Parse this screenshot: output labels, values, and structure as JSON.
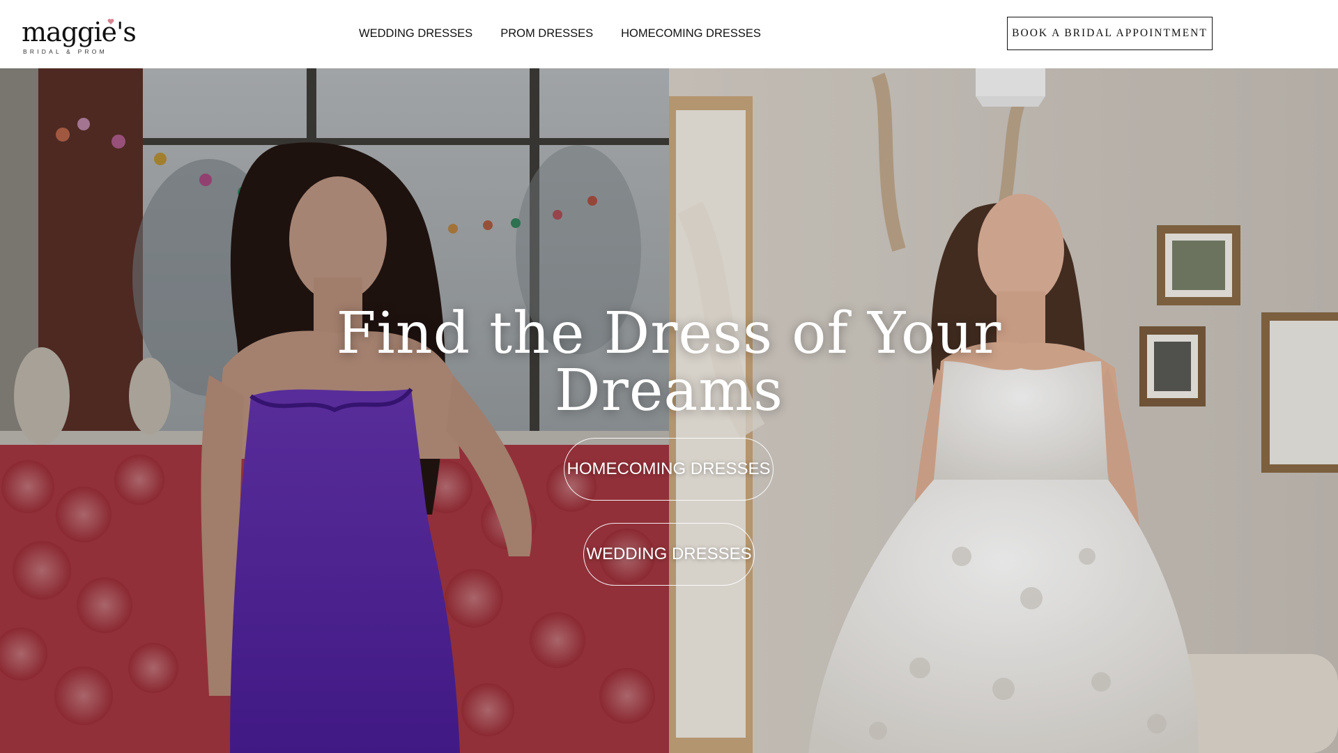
{
  "brand": {
    "name": "maggie's",
    "tagline": "BRIDAL & PROM"
  },
  "nav": {
    "items": [
      {
        "label": "WEDDING DRESSES"
      },
      {
        "label": "PROM DRESSES"
      },
      {
        "label": "HOMECOMING DRESSES"
      }
    ]
  },
  "header": {
    "cta_label": "BOOK A BRIDAL APPOINTMENT"
  },
  "hero": {
    "title_line1": "Find the Dress of Your",
    "title_line2": "Dreams",
    "buttons": [
      {
        "label": "HOMECOMING DRESSES"
      },
      {
        "label": "WEDDING DRESSES"
      }
    ]
  },
  "colors": {
    "header_bg": "#ffffff",
    "text_dark": "#111111",
    "hero_text": "#ffffff",
    "prom_dress": "#6a2fc9",
    "rose_wall": "#c9434f",
    "wedding_dress": "#f2f0ec",
    "logo_heart": "#d7848f"
  },
  "icons": [
    "logo-heart-icon"
  ]
}
